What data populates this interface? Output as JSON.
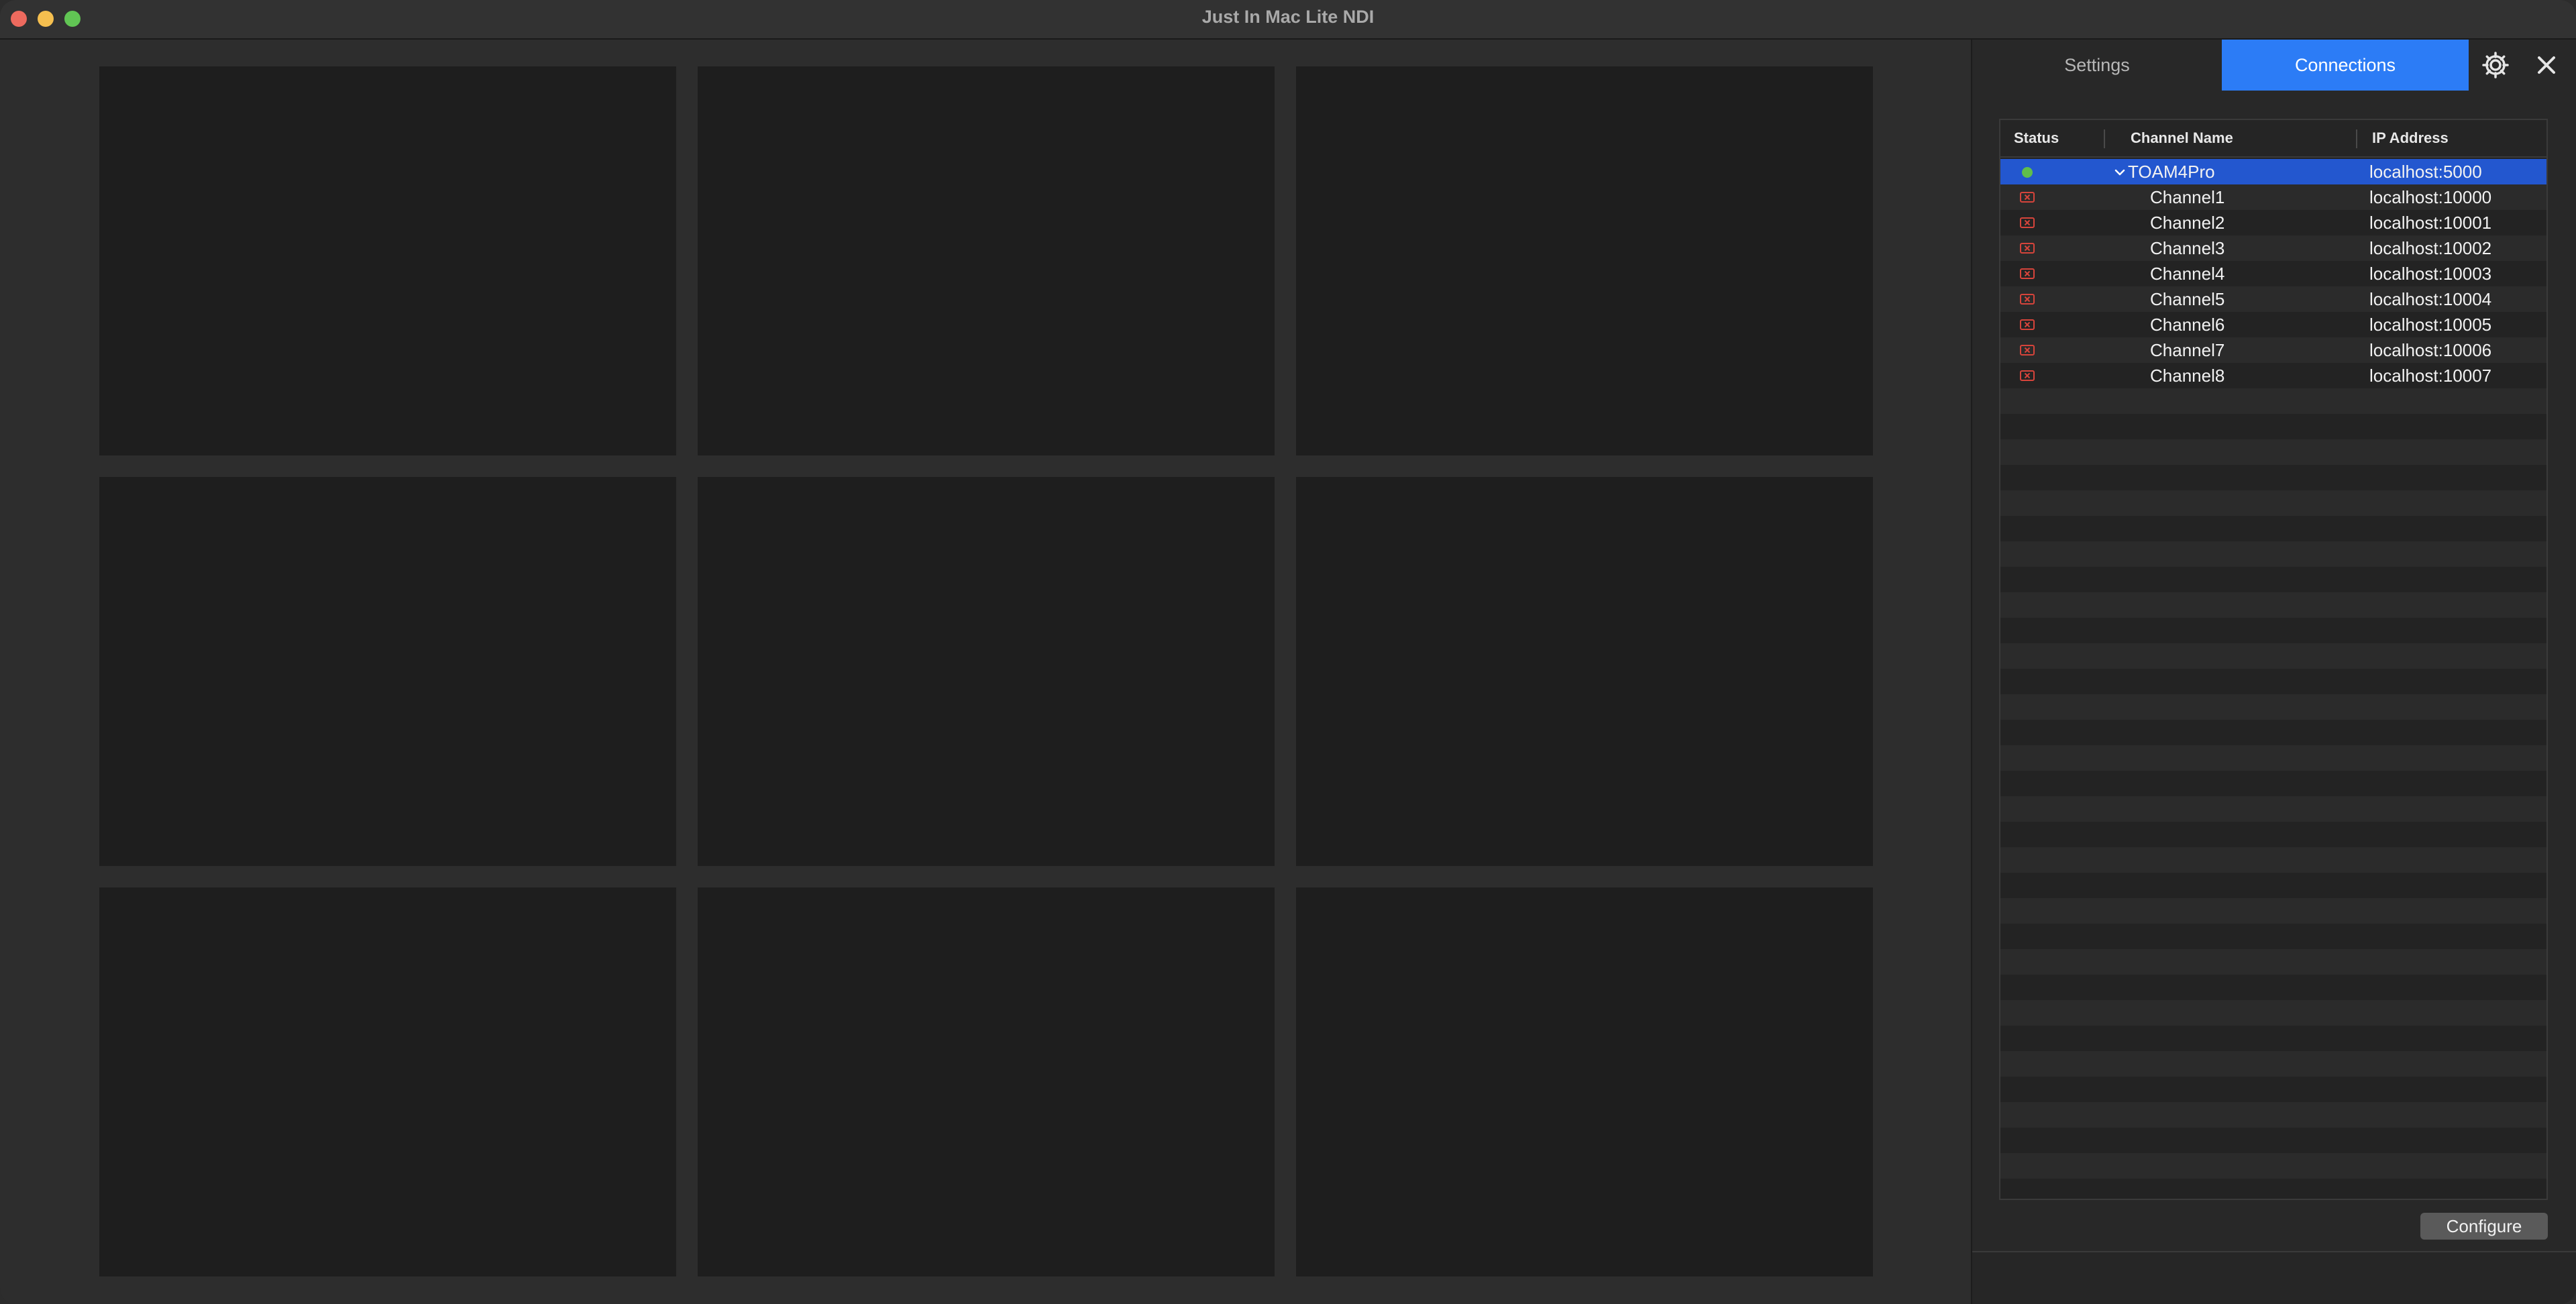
{
  "window": {
    "title": "Just In Mac Lite NDI"
  },
  "sidebar": {
    "tabs": {
      "settings": "Settings",
      "connections": "Connections"
    },
    "icons": {
      "gear": "gear-icon",
      "close": "close-icon"
    },
    "table": {
      "headers": {
        "status": "Status",
        "name": "Channel Name",
        "ip": "IP Address"
      },
      "rows": [
        {
          "name": "TOAM4Pro",
          "ip": "localhost:5000",
          "status": "connected",
          "selected": true,
          "expanded": true
        },
        {
          "name": "Channel1",
          "ip": "localhost:10000",
          "status": "error"
        },
        {
          "name": "Channel2",
          "ip": "localhost:10001",
          "status": "error"
        },
        {
          "name": "Channel3",
          "ip": "localhost:10002",
          "status": "error"
        },
        {
          "name": "Channel4",
          "ip": "localhost:10003",
          "status": "error"
        },
        {
          "name": "Channel5",
          "ip": "localhost:10004",
          "status": "error"
        },
        {
          "name": "Channel6",
          "ip": "localhost:10005",
          "status": "error"
        },
        {
          "name": "Channel7",
          "ip": "localhost:10006",
          "status": "error"
        },
        {
          "name": "Channel8",
          "ip": "localhost:10007",
          "status": "error"
        }
      ]
    },
    "configure_label": "Configure"
  },
  "colors": {
    "accent": "#2c7cf6",
    "selected_row": "#2357cf",
    "status_ok": "#5fbe4b",
    "status_error": "#d6443b"
  }
}
